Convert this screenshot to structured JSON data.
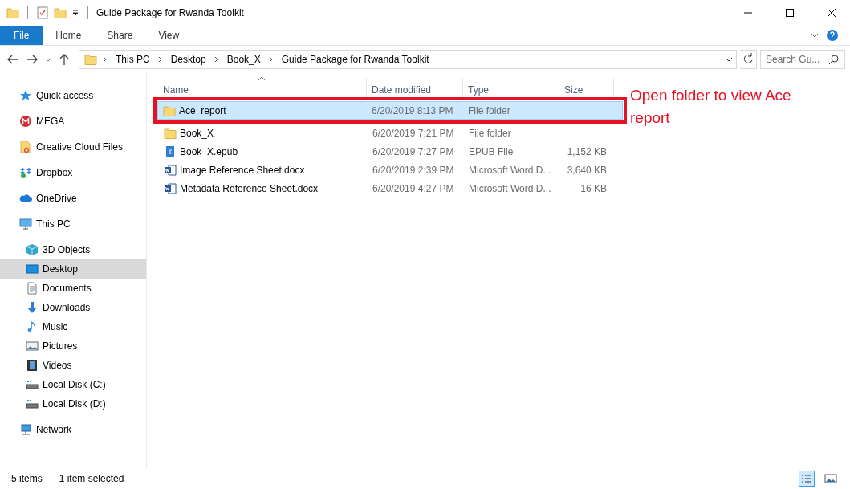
{
  "window": {
    "title": "Guide Package for Rwanda Toolkit"
  },
  "ribbon": {
    "tabs": [
      {
        "label": "File",
        "kind": "file",
        "selected": false
      },
      {
        "label": "Home",
        "kind": "tab",
        "selected": false
      },
      {
        "label": "Share",
        "kind": "tab",
        "selected": false
      },
      {
        "label": "View",
        "kind": "tab",
        "selected": false
      }
    ]
  },
  "address_bar": {
    "crumbs": [
      "This PC",
      "Desktop",
      "Book_X",
      "Guide Package for Rwanda Toolkit"
    ]
  },
  "search": {
    "placeholder": "Search Gu..."
  },
  "sidebar": {
    "items": [
      {
        "label": "Quick access",
        "kind": "star",
        "selected": false
      },
      {
        "label": "MEGA",
        "kind": "mega",
        "selected": false
      },
      {
        "label": "Creative Cloud Files",
        "kind": "cc",
        "selected": false
      },
      {
        "label": "Dropbox",
        "kind": "dropbox",
        "selected": false
      },
      {
        "label": "OneDrive",
        "kind": "cloud",
        "selected": false
      },
      {
        "label": "This PC",
        "kind": "pc",
        "selected": false,
        "children": [
          {
            "label": "3D Objects",
            "kind": "cube",
            "selected": false
          },
          {
            "label": "Desktop",
            "kind": "desktop",
            "selected": true
          },
          {
            "label": "Documents",
            "kind": "doc",
            "selected": false
          },
          {
            "label": "Downloads",
            "kind": "download",
            "selected": false
          },
          {
            "label": "Music",
            "kind": "music",
            "selected": false
          },
          {
            "label": "Pictures",
            "kind": "picture",
            "selected": false
          },
          {
            "label": "Videos",
            "kind": "video",
            "selected": false
          },
          {
            "label": "Local Disk (C:)",
            "kind": "disk",
            "selected": false
          },
          {
            "label": "Local Disk (D:)",
            "kind": "disk",
            "selected": false
          }
        ]
      },
      {
        "label": "Network",
        "kind": "network",
        "selected": false
      }
    ]
  },
  "file_list": {
    "columns": [
      "Name",
      "Date modified",
      "Type",
      "Size"
    ],
    "rows": [
      {
        "name": "Ace_report",
        "date": "6/20/2019 8:13 PM",
        "type": "File folder",
        "kind": "folder",
        "selected": true,
        "annotated": true
      },
      {
        "name": "Book_X",
        "date": "6/20/2019 7:21 PM",
        "type": "File folder",
        "kind": "folder",
        "selected": false,
        "annotated": false
      },
      {
        "name": "Book_X.epub",
        "date": "6/20/2019 7:27 PM",
        "type": "EPUB File",
        "size": "1,152 KB",
        "kind": "epub",
        "selected": false,
        "annotated": false
      },
      {
        "name": "Image Reference Sheet.docx",
        "date": "6/20/2019 2:39 PM",
        "type": "Microsoft Word D...",
        "size": "3,640 KB",
        "kind": "word",
        "selected": false,
        "annotated": false
      },
      {
        "name": "Metadata Reference Sheet.docx",
        "date": "6/20/2019 4:27 PM",
        "type": "Microsoft Word D...",
        "size": "16 KB",
        "kind": "word",
        "selected": false,
        "annotated": false
      }
    ]
  },
  "annotation": {
    "text": "Open folder to view Ace report"
  },
  "status_bar": {
    "items": "5 items",
    "selection": "1 item selected"
  }
}
